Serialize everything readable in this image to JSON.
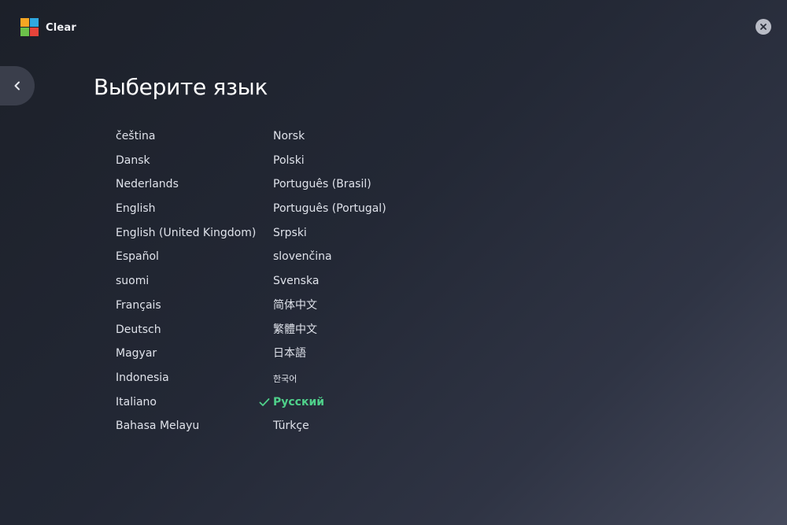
{
  "header": {
    "app_name": "Clear",
    "logo_colors": [
      "#f6a623",
      "#2fa8e0",
      "#6cc24a",
      "#e5443a"
    ]
  },
  "page": {
    "title": "Выберите язык"
  },
  "languages": {
    "left": [
      "čeština",
      "Dansk",
      "Nederlands",
      "English",
      "English (United Kingdom)",
      "Español",
      "suomi",
      "Français",
      "Deutsch",
      "Magyar",
      "Indonesia",
      "Italiano",
      "Bahasa Melayu"
    ],
    "right": [
      "Norsk",
      "Polski",
      "Português (Brasil)",
      "Português (Portugal)",
      "Srpski",
      "slovenčina",
      "Svenska",
      "简体中文",
      "繁體中文",
      "日本語",
      "한국어",
      "Русский",
      "Türkçe"
    ],
    "selected": "Русский"
  },
  "colors": {
    "accent": "#4fd08a",
    "back_button": "#3a3e4b",
    "close_button": "#b9bcc6"
  },
  "icons": {
    "back": "chevron-left-icon",
    "close": "close-icon",
    "check": "check-icon"
  }
}
